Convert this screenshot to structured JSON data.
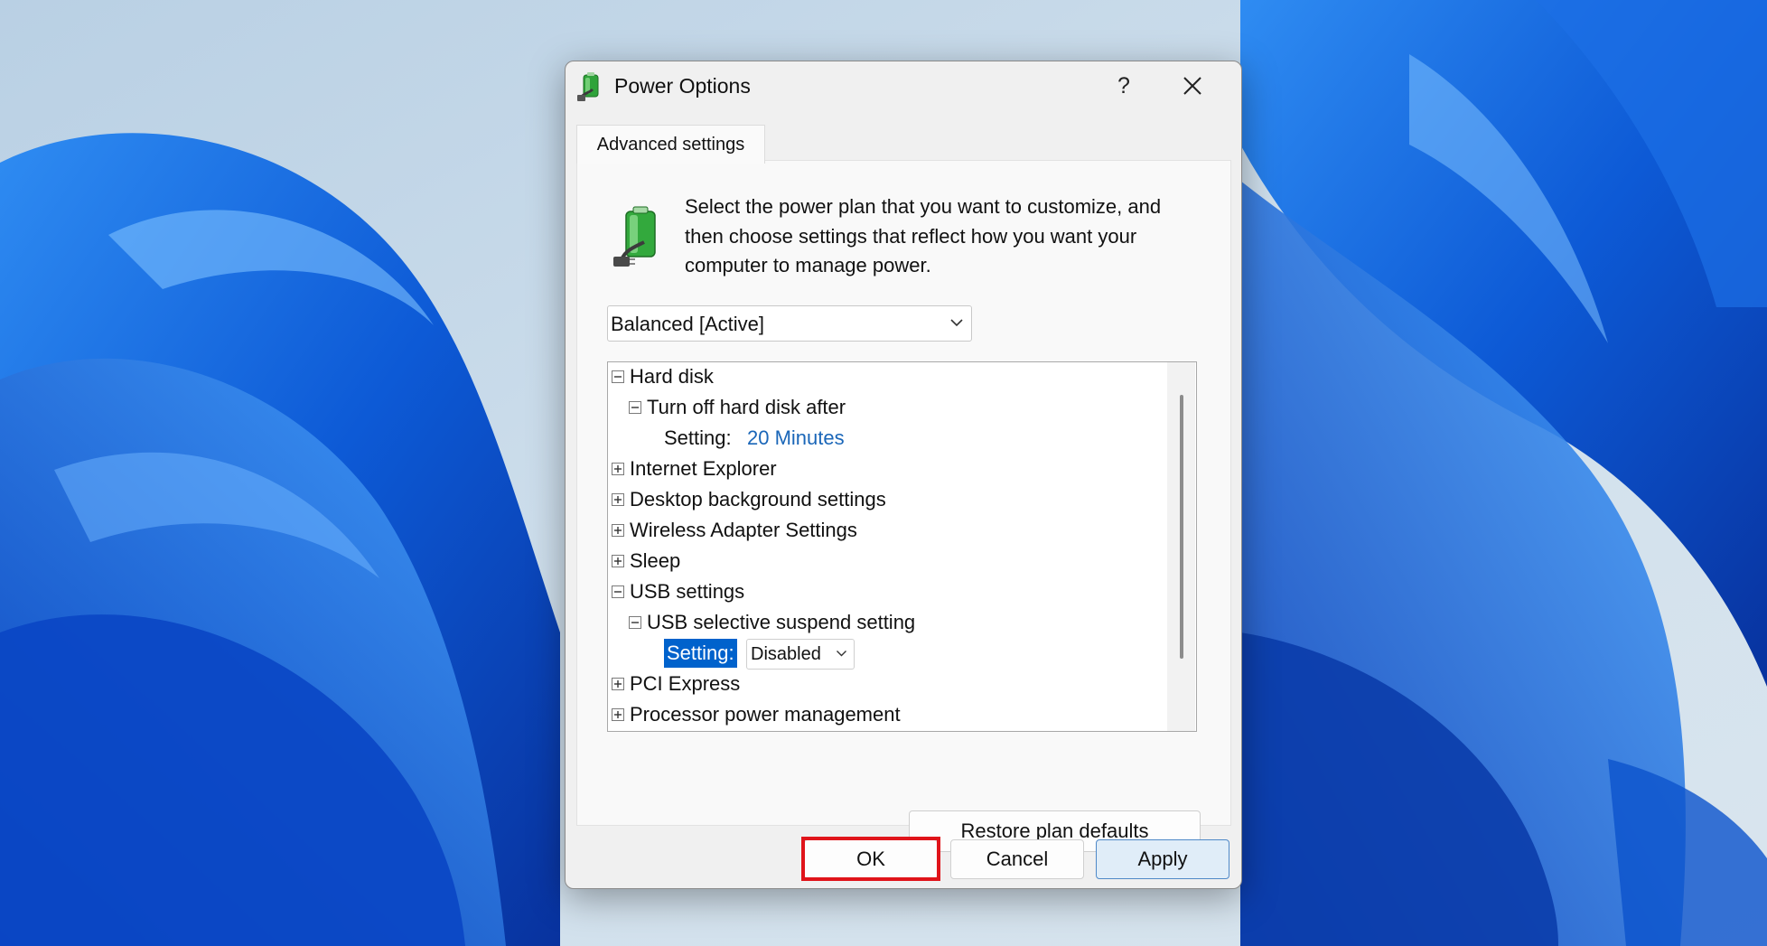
{
  "window": {
    "title": "Power Options",
    "help_label": "?",
    "close_icon": "close-icon",
    "app_icon": "power-options-icon"
  },
  "tabs": [
    {
      "label": "Advanced settings",
      "selected": true
    }
  ],
  "intro_text": "Select the power plan that you want to customize, and then choose settings that reflect how you want your computer to manage power.",
  "plan_select": {
    "value": "Balanced [Active]"
  },
  "tree": {
    "items": [
      {
        "label": "Hard disk",
        "expander": "minus"
      },
      {
        "label": "Turn off hard disk after",
        "expander": "minus"
      },
      {
        "setting_label": "Setting:",
        "setting_value": "20 Minutes"
      },
      {
        "label": "Internet Explorer",
        "expander": "plus"
      },
      {
        "label": "Desktop background settings",
        "expander": "plus"
      },
      {
        "label": "Wireless Adapter Settings",
        "expander": "plus"
      },
      {
        "label": "Sleep",
        "expander": "plus"
      },
      {
        "label": "USB settings",
        "expander": "minus"
      },
      {
        "label": "USB selective suspend setting",
        "expander": "minus"
      },
      {
        "setting_label": "Setting:",
        "setting_value": "Disabled",
        "selected": true
      },
      {
        "label": "PCI Express",
        "expander": "plus"
      },
      {
        "label": "Processor power management",
        "expander": "plus"
      }
    ]
  },
  "buttons": {
    "restore": "Restore plan defaults",
    "ok": "OK",
    "cancel": "Cancel",
    "apply": "Apply"
  },
  "colors": {
    "accent": "#0062cc",
    "link_value": "#1a66b8",
    "highlight_box": "#e0141a",
    "wallpaper_blue": "#0b5bd8"
  }
}
